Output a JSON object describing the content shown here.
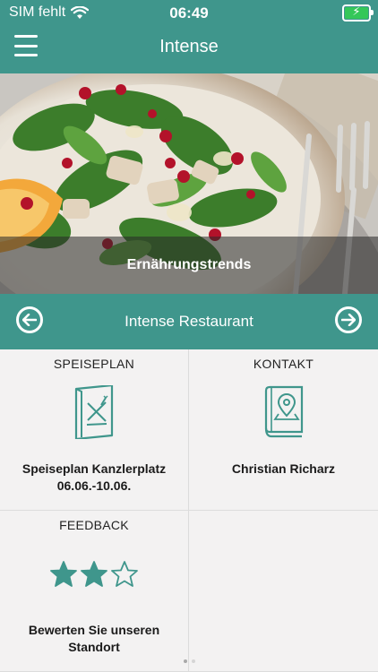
{
  "status_bar": {
    "carrier": "SIM fehlt",
    "time": "06:49",
    "wifi_icon": "wifi-icon",
    "battery_icon": "battery-charging-icon"
  },
  "nav": {
    "title": "Intense",
    "menu_icon": "hamburger-menu-icon"
  },
  "hero": {
    "caption": "Ernährungstrends"
  },
  "restaurant": {
    "name": "Intense Restaurant",
    "prev_icon": "arrow-left-circle-icon",
    "next_icon": "arrow-right-circle-icon"
  },
  "tiles": {
    "menu": {
      "heading": "SPEISEPLAN",
      "line1": "Speiseplan Kanzlerplatz",
      "line2": "06.06.-10.06.",
      "icon": "menu-card-icon"
    },
    "contact": {
      "heading": "KONTAKT",
      "name": "Christian Richarz",
      "icon": "address-book-icon"
    },
    "feedback": {
      "heading": "FEEDBACK",
      "line1": "Bewerten Sie unseren",
      "line2": "Standort",
      "rating": 2,
      "max_rating": 5,
      "icon": "star-rating-icon"
    }
  },
  "pager": {
    "pages": 2,
    "current": 1
  },
  "colors": {
    "accent": "#3f968c",
    "tile_background": "#f3f2f2",
    "star": "#3f968c"
  }
}
